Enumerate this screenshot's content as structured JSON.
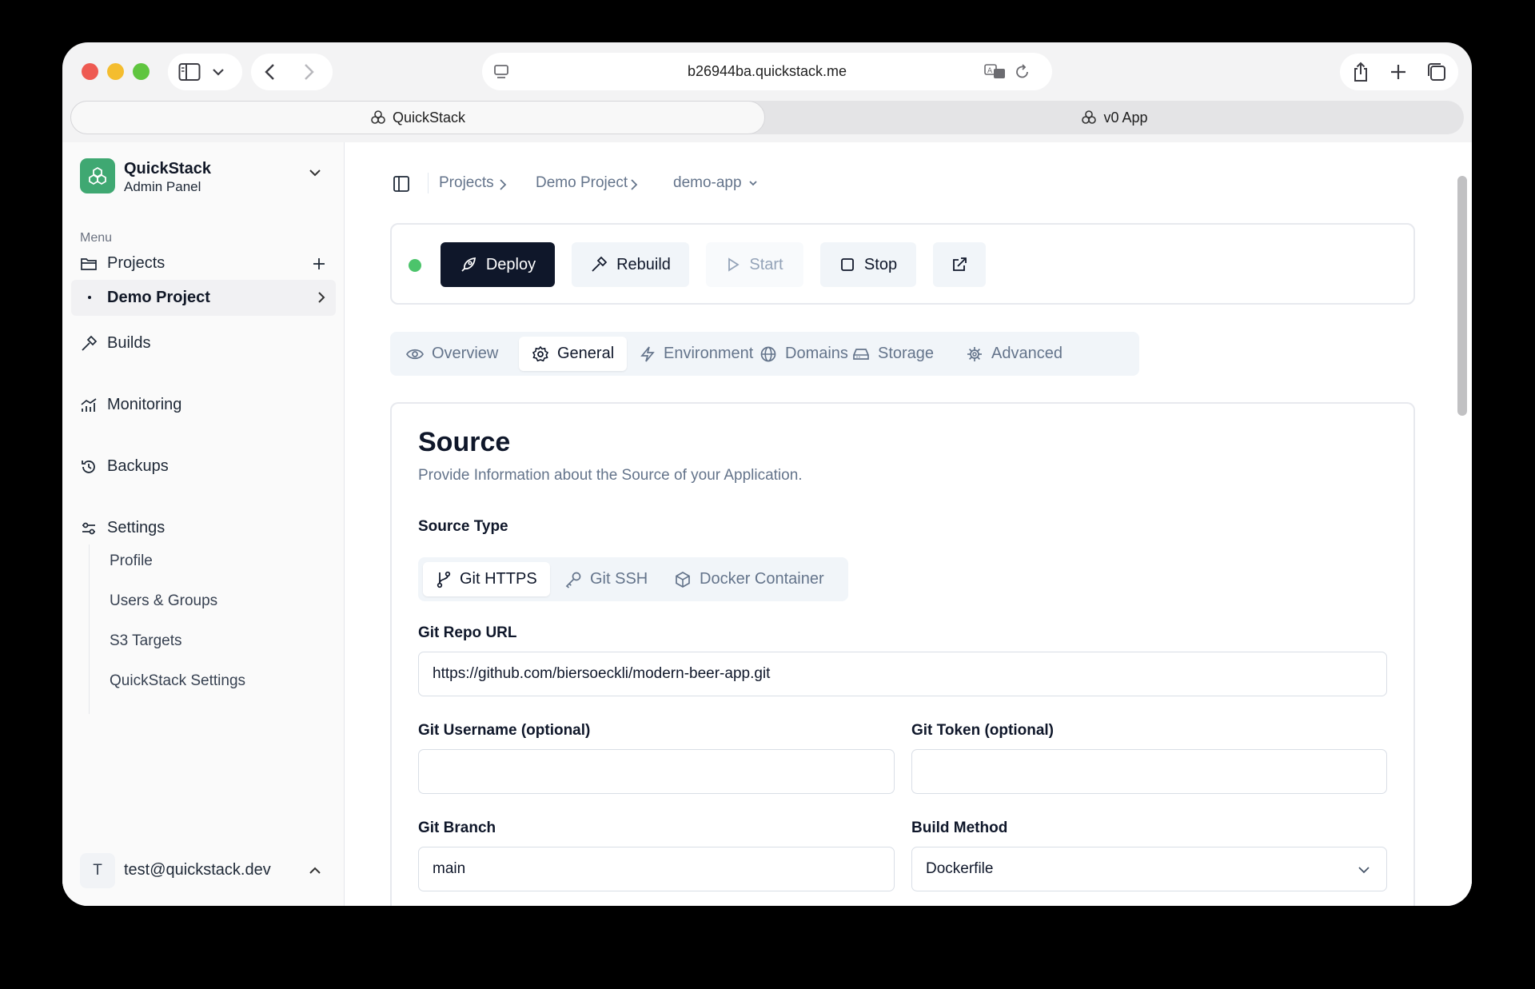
{
  "browser": {
    "url": "b26944ba.quickstack.me",
    "tabs": [
      {
        "label": "QuickStack",
        "active": true
      },
      {
        "label": "v0 App",
        "active": false
      }
    ]
  },
  "sidebar": {
    "brand_name": "QuickStack",
    "brand_sub": "Admin Panel",
    "menu_heading": "Menu",
    "projects_label": "Projects",
    "current_project": "Demo Project",
    "builds_label": "Builds",
    "monitoring_label": "Monitoring",
    "backups_label": "Backups",
    "settings_label": "Settings",
    "settings_items": [
      "Profile",
      "Users & Groups",
      "S3 Targets",
      "QuickStack Settings"
    ],
    "user_initial": "T",
    "user_email": "test@quickstack.dev"
  },
  "breadcrumb": {
    "items": [
      "Projects",
      "Demo Project",
      "demo-app"
    ]
  },
  "actions": {
    "status_color": "#4cc46b",
    "deploy": "Deploy",
    "rebuild": "Rebuild",
    "start": "Start",
    "stop": "Stop"
  },
  "tabs": [
    "Overview",
    "General",
    "Environment",
    "Domains",
    "Storage",
    "Advanced"
  ],
  "active_tab": "General",
  "source": {
    "title": "Source",
    "description": "Provide Information about the Source of your Application.",
    "source_type_label": "Source Type",
    "source_types": [
      "Git HTTPS",
      "Git SSH",
      "Docker Container"
    ],
    "git_repo_label": "Git Repo URL",
    "git_repo_value": "https://github.com/biersoeckli/modern-beer-app.git",
    "git_username_label": "Git Username (optional)",
    "git_username_value": "",
    "git_token_label": "Git Token (optional)",
    "git_token_value": "",
    "git_branch_label": "Git Branch",
    "git_branch_value": "main",
    "build_method_label": "Build Method",
    "build_method_value": "Dockerfile"
  }
}
